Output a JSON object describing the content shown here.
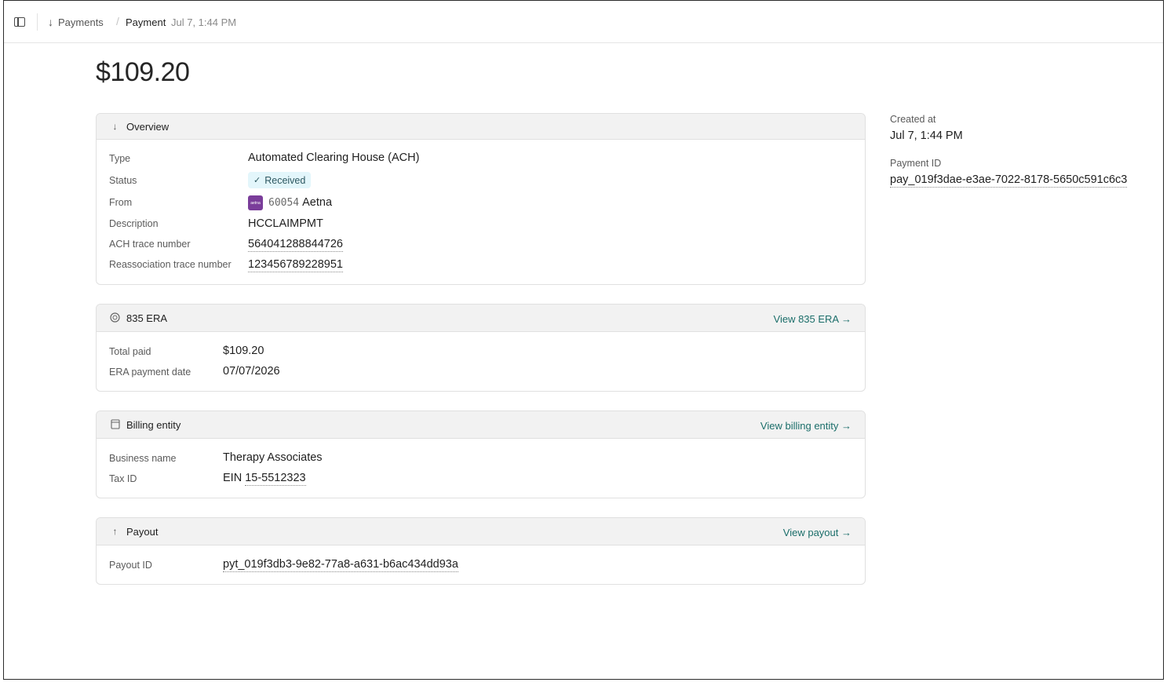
{
  "breadcrumb": {
    "parent_label": "Payments",
    "separator": "/",
    "current_label": "Payment",
    "timestamp": "Jul 7, 1:44 PM"
  },
  "payment": {
    "amount": "$109.20"
  },
  "overview": {
    "title": "Overview",
    "type_label": "Type",
    "type_value": "Automated Clearing House (ACH)",
    "status_label": "Status",
    "status_value": "Received",
    "from_label": "From",
    "from_payer_id": "60054",
    "from_payer_name": "Aetna",
    "from_logo_text": "aetna",
    "description_label": "Description",
    "description_value": "HCCLAIMPMT",
    "ach_trace_label": "ACH trace number",
    "ach_trace_value": "564041288844726",
    "reassoc_label": "Reassociation trace number",
    "reassoc_value": "123456789228951"
  },
  "era": {
    "title": "835 ERA",
    "link": "View 835 ERA →",
    "total_paid_label": "Total paid",
    "total_paid_value": "$109.20",
    "payment_date_label": "ERA payment date",
    "payment_date_value": "07/07/2026"
  },
  "billing": {
    "title": "Billing entity",
    "link": "View billing entity →",
    "business_name_label": "Business name",
    "business_name_value": "Therapy Associates",
    "tax_id_label": "Tax ID",
    "tax_id_prefix": "EIN",
    "tax_id_value": "15-5512323"
  },
  "payout": {
    "title": "Payout",
    "link": "View payout →",
    "payout_id_label": "Payout ID",
    "payout_id_value": "pyt_019f3db3-9e82-77a8-a631-b6ac434dd93a"
  },
  "sidebar": {
    "created_label": "Created at",
    "created_value": "Jul 7, 1:44 PM",
    "payment_id_label": "Payment ID",
    "payment_id_value": "pay_019f3dae-e3ae-7022-8178-5650c591c6c3"
  },
  "colors": {
    "link": "#1b6e6a",
    "status_badge_bg": "#e3f6fb",
    "payer_logo_bg": "#7a3d9a"
  }
}
